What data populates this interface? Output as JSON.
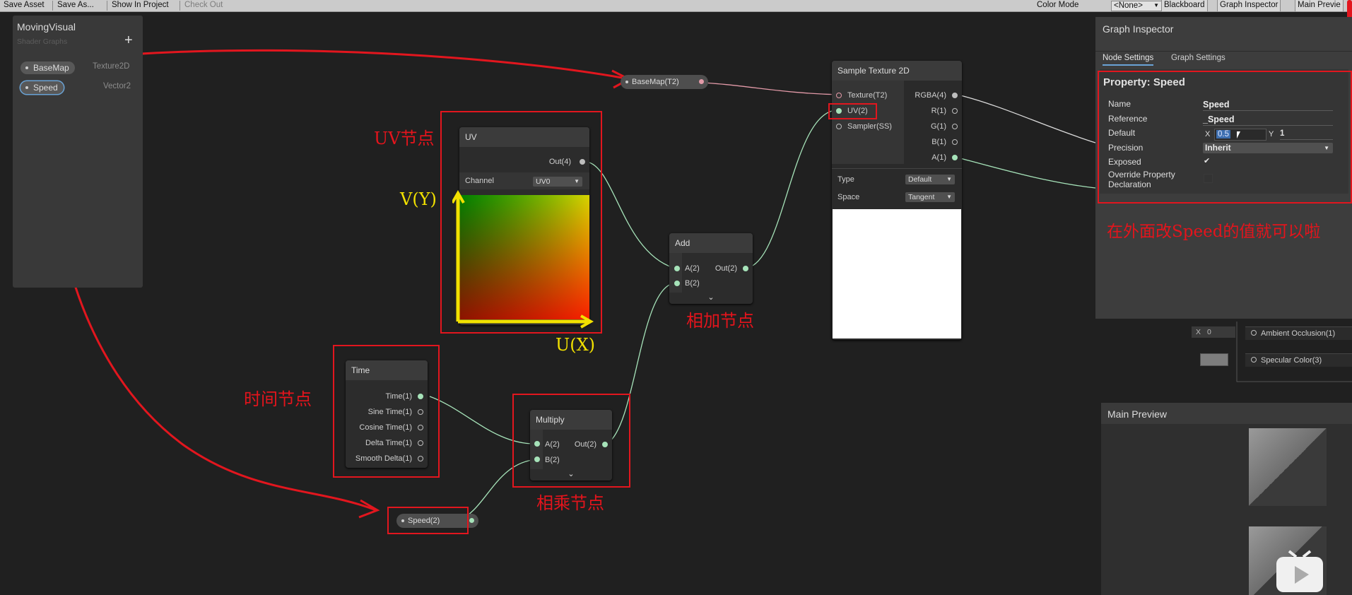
{
  "toolbar": {
    "save_asset": "Save Asset",
    "save_as": "Save As...",
    "show_in_project": "Show In Project",
    "check_out": "Check Out",
    "color_mode_label": "Color Mode",
    "color_mode_value": "<None>",
    "blackboard": "Blackboard",
    "graph_inspector": "Graph Inspector",
    "main_preview": "Main Previe"
  },
  "blackboard": {
    "title": "MovingVisual",
    "subtitle": "Shader Graphs",
    "add": "+",
    "properties": [
      {
        "name": "BaseMap",
        "type": "Texture2D"
      },
      {
        "name": "Speed",
        "type": "Vector2"
      }
    ]
  },
  "nodes": {
    "basemap_prop": "BaseMap(T2)",
    "speed_prop": "Speed(2)",
    "uv": {
      "title": "UV",
      "out": "Out(4)",
      "channel_label": "Channel",
      "channel_value": "UV0"
    },
    "sample": {
      "title": "Sample Texture 2D",
      "inputs": [
        "Texture(T2)",
        "UV(2)",
        "Sampler(SS)"
      ],
      "outputs": [
        "RGBA(4)",
        "R(1)",
        "G(1)",
        "B(1)",
        "A(1)"
      ],
      "type_label": "Type",
      "type_value": "Default",
      "space_label": "Space",
      "space_value": "Tangent"
    },
    "add": {
      "title": "Add",
      "in_a": "A(2)",
      "in_b": "B(2)",
      "out": "Out(2)"
    },
    "time": {
      "title": "Time",
      "outputs": [
        "Time(1)",
        "Sine Time(1)",
        "Cosine Time(1)",
        "Delta Time(1)",
        "Smooth Delta(1)"
      ]
    },
    "multiply": {
      "title": "Multiply",
      "in_a": "A(2)",
      "in_b": "B(2)",
      "out": "Out(2)"
    },
    "master": {
      "x_label": "X",
      "x_value": "0",
      "ao": "Ambient Occlusion(1)",
      "spec": "Specular Color(3)"
    }
  },
  "inspector": {
    "title": "Graph Inspector",
    "tabs": [
      "Node Settings",
      "Graph Settings"
    ],
    "property_heading": "Property: Speed",
    "rows": {
      "name_label": "Name",
      "name_value": "Speed",
      "reference_label": "Reference",
      "reference_value": "_Speed",
      "default_label": "Default",
      "x_label": "X",
      "x_value": "0.5",
      "y_label": "Y",
      "y_value": "1",
      "precision_label": "Precision",
      "precision_value": "Inherit",
      "exposed_label": "Exposed",
      "exposed_check": "✔",
      "override_label_1": "Override Property",
      "override_label_2": "Declaration"
    }
  },
  "main_preview": {
    "title": "Main Preview"
  },
  "annotations": {
    "uv_node": "UV节点",
    "v_axis": "V(Y)",
    "u_axis": "U(X)",
    "add_node": "相加节点",
    "time_node": "时间节点",
    "multiply_node": "相乘节点",
    "speed_note": "在外面改Speed的值就可以啦"
  },
  "colors": {
    "annotation_red": "#e2161e",
    "axis_yellow": "#f2e100",
    "edge_green": "#a6e3b9",
    "edge_pink": "#e39aa8",
    "selection_blue": "#3d6fb0"
  }
}
